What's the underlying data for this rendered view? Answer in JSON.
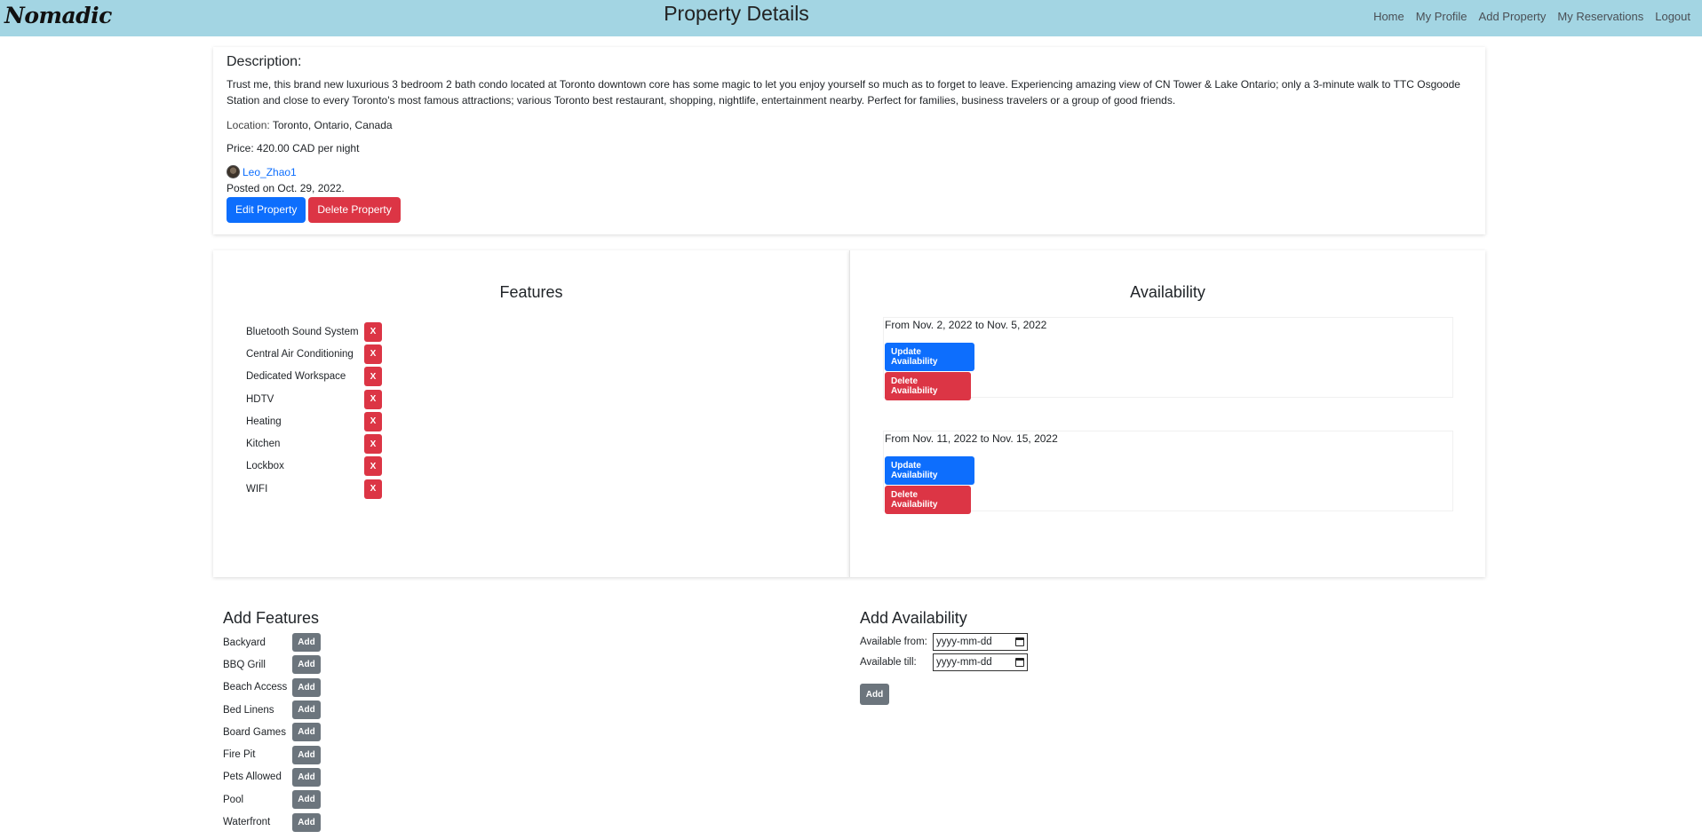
{
  "nav": {
    "brand": "Nomadic",
    "title": "Property Details",
    "links": [
      "Home",
      "My Profile",
      "Add Property",
      "My Reservations",
      "Logout"
    ]
  },
  "property": {
    "description_heading": "Description:",
    "description": "Trust me, this brand new luxurious 3 bedroom 2 bath condo located at Toronto downtown core has some magic to let you enjoy yourself so much as to forget to leave. Experiencing amazing view of CN Tower & Lake Ontario; only a 3-minute walk to TTC Osgoode Station and close to every Toronto's most famous attractions; various Toronto best restaurant, shopping, nightlife, entertainment nearby. Perfect for families, business travelers or a group of good friends.",
    "location_label": "Location:",
    "location": "Toronto, Ontario, Canada",
    "price_label": "Price:",
    "price": "420.00 CAD per night",
    "host": "Leo_Zhao1",
    "posted": "Posted on Oct. 29, 2022.",
    "edit_label": "Edit Property",
    "delete_label": "Delete Property"
  },
  "features": {
    "title": "Features",
    "remove_label": "X",
    "items": [
      "Bluetooth Sound System",
      "Central Air Conditioning",
      "Dedicated Workspace",
      "HDTV",
      "Heating",
      "Kitchen",
      "Lockbox",
      "WIFI"
    ]
  },
  "availability": {
    "title": "Availability",
    "update_label": "Update Availability",
    "delete_label": "Delete Availability",
    "ranges": [
      "From Nov. 2, 2022 to Nov. 5, 2022",
      "From Nov. 11, 2022 to Nov. 15, 2022"
    ]
  },
  "add_features": {
    "title": "Add Features",
    "add_label": "Add",
    "items": [
      "Backyard",
      "BBQ Grill",
      "Beach Access",
      "Bed Linens",
      "Board Games",
      "Fire Pit",
      "Pets Allowed",
      "Pool",
      "Waterfront"
    ]
  },
  "add_availability": {
    "title": "Add Availability",
    "from_label": "Available from:",
    "till_label": "Available till:",
    "date_placeholder": "yyyy-mm-dd",
    "add_label": "Add"
  },
  "colors": {
    "navbar": "#a3d5e3",
    "primary": "#0d6efd",
    "danger": "#dc3545",
    "secondary": "#6c757d"
  }
}
